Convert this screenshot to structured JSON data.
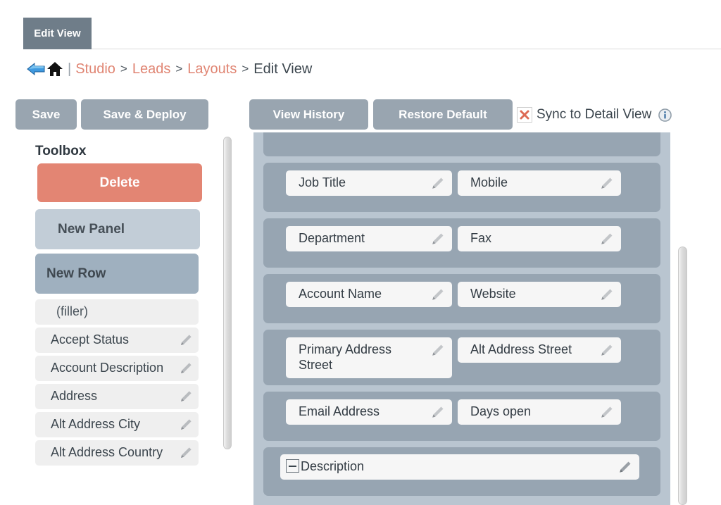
{
  "tab": {
    "label": "Edit View"
  },
  "breadcrumb": {
    "back_icon": "back-arrow-icon",
    "home_icon": "home-icon",
    "separator": "|",
    "chevron": ">",
    "links": [
      "Studio",
      "Leads",
      "Layouts"
    ],
    "current": "Edit View"
  },
  "toolbar": {
    "save_label": "Save",
    "save_deploy_label": "Save & Deploy",
    "view_history_label": "View History",
    "restore_default_label": "Restore Default",
    "sync_label": "Sync to Detail View",
    "sync_checked_icon": "x-mark-icon",
    "info_icon": "info-icon"
  },
  "toolbox": {
    "title": "Toolbox",
    "delete_label": "Delete",
    "new_panel_label": "New Panel",
    "new_row_label": "New Row",
    "fields": [
      {
        "label": "(filler)",
        "editable": false
      },
      {
        "label": "Accept Status",
        "editable": true
      },
      {
        "label": "Account Description",
        "editable": true
      },
      {
        "label": "Address",
        "editable": true
      },
      {
        "label": "Alt Address City",
        "editable": true
      },
      {
        "label": "Alt Address Country",
        "editable": true
      }
    ]
  },
  "canvas": {
    "rows": [
      {
        "partial": true,
        "left": null,
        "right": null
      },
      {
        "partial": false,
        "left": "Job Title",
        "right": "Mobile"
      },
      {
        "partial": false,
        "left": "Department",
        "right": "Fax"
      },
      {
        "partial": false,
        "left": "Account Name",
        "right": "Website"
      },
      {
        "partial": false,
        "left": "Primary Address Street",
        "right": "Alt Address Street",
        "tall": true
      },
      {
        "partial": false,
        "left": "Email Address",
        "right": "Days open"
      }
    ],
    "wide_row": {
      "label": "Description",
      "collapse_icon": "collapse-minus-icon"
    }
  },
  "scrollbars": {
    "left": "left-list-scrollbar",
    "right": "canvas-scrollbar"
  },
  "colors": {
    "accent_link": "#e08573",
    "button": "#99a5b0",
    "delete": "#e38573",
    "row": "#97a5b2",
    "canvas": "#b9c5d0",
    "tab": "#6f7d89"
  }
}
